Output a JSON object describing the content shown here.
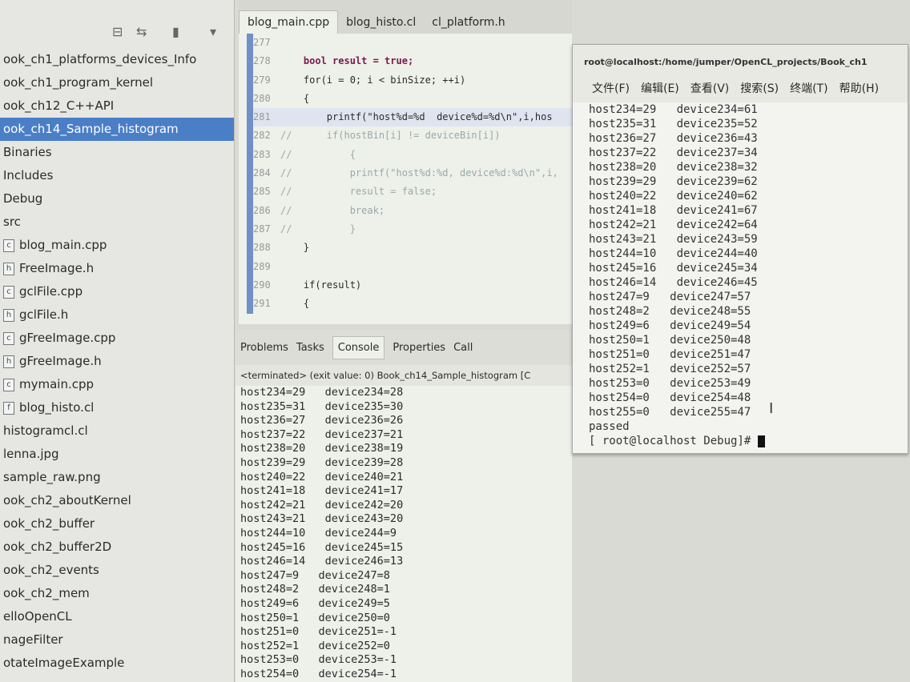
{
  "sidebar": {
    "items": [
      {
        "label": "ook_ch1_platforms_devices_Info",
        "icon": ""
      },
      {
        "label": "ook_ch1_program_kernel",
        "icon": ""
      },
      {
        "label": "ook_ch12_C++API",
        "icon": ""
      },
      {
        "label": "ook_ch14_Sample_histogram",
        "icon": "",
        "selected": true
      },
      {
        "label": "Binaries",
        "icon": ""
      },
      {
        "label": "Includes",
        "icon": ""
      },
      {
        "label": "Debug",
        "icon": ""
      },
      {
        "label": "src",
        "icon": ""
      },
      {
        "label": "blog_main.cpp",
        "icon": "c"
      },
      {
        "label": "FreeImage.h",
        "icon": "h"
      },
      {
        "label": "gclFile.cpp",
        "icon": "c"
      },
      {
        "label": "gclFile.h",
        "icon": "h"
      },
      {
        "label": "gFreeImage.cpp",
        "icon": "c"
      },
      {
        "label": "gFreeImage.h",
        "icon": "h"
      },
      {
        "label": "mymain.cpp",
        "icon": "c"
      },
      {
        "label": "blog_histo.cl",
        "icon": "f"
      },
      {
        "label": "histogramcl.cl",
        "icon": ""
      },
      {
        "label": "lenna.jpg",
        "icon": ""
      },
      {
        "label": "sample_raw.png",
        "icon": ""
      },
      {
        "label": "ook_ch2_aboutKernel",
        "icon": ""
      },
      {
        "label": "ook_ch2_buffer",
        "icon": ""
      },
      {
        "label": "ook_ch2_buffer2D",
        "icon": ""
      },
      {
        "label": "ook_ch2_events",
        "icon": ""
      },
      {
        "label": "ook_ch2_mem",
        "icon": ""
      },
      {
        "label": "elloOpenCL",
        "icon": ""
      },
      {
        "label": "nageFilter",
        "icon": ""
      },
      {
        "label": "otateImageExample",
        "icon": ""
      }
    ]
  },
  "editor": {
    "tabs": [
      "blog_main.cpp",
      "blog_histo.cl",
      "cl_platform.h"
    ],
    "lines": [
      {
        "n": "277",
        "code": "",
        "t": ""
      },
      {
        "n": "278",
        "code": "    bool result = true;",
        "t": "kw"
      },
      {
        "n": "279",
        "code": "    for(i = 0; i < binSize; ++i)",
        "t": ""
      },
      {
        "n": "280",
        "code": "    {",
        "t": ""
      },
      {
        "n": "281",
        "code": "        printf(\"host%d=%d  device%d=%d\\n\",i,hos",
        "t": "hl"
      },
      {
        "n": "282",
        "code": "//      if(hostBin[i] != deviceBin[i])",
        "t": "cm"
      },
      {
        "n": "283",
        "code": "//          {",
        "t": "cm"
      },
      {
        "n": "284",
        "code": "//          printf(\"host%d:%d, device%d:%d\\n\",i,",
        "t": "cm"
      },
      {
        "n": "285",
        "code": "//          result = false;",
        "t": "cm"
      },
      {
        "n": "286",
        "code": "//          break;",
        "t": "cm"
      },
      {
        "n": "287",
        "code": "//          }",
        "t": "cm"
      },
      {
        "n": "288",
        "code": "    }",
        "t": ""
      },
      {
        "n": "289",
        "code": "",
        "t": ""
      },
      {
        "n": "290",
        "code": "    if(result)",
        "t": ""
      },
      {
        "n": "291",
        "code": "    {",
        "t": ""
      }
    ]
  },
  "console": {
    "tabs": [
      "Problems",
      "Tasks",
      "Console",
      "Properties",
      "Call"
    ],
    "status": "<terminated> (exit value: 0) Book_ch14_Sample_histogram [C",
    "rows": [
      "host234=29   device234=28",
      "host235=31   device235=30",
      "host236=27   device236=26",
      "host237=22   device237=21",
      "host238=20   device238=19",
      "host239=29   device239=28",
      "host240=22   device240=21",
      "host241=18   device241=17",
      "host242=21   device242=20",
      "host243=21   device243=20",
      "host244=10   device244=9",
      "host245=16   device245=15",
      "host246=14   device246=13",
      "host247=9   device247=8",
      "host248=2   device248=1",
      "host249=6   device249=5",
      "host250=1   device250=0",
      "host251=0   device251=-1",
      "host252=1   device252=0",
      "host253=0   device253=-1",
      "host254=0   device254=-1"
    ]
  },
  "terminal": {
    "title": "root@localhost:/home/jumper/OpenCL_projects/Book_ch1",
    "menu": [
      "文件(F)",
      "编辑(E)",
      "查看(V)",
      "搜索(S)",
      "终端(T)",
      "帮助(H)"
    ],
    "rows": [
      "host234=29   device234=61",
      "host235=31   device235=52",
      "host236=27   device236=43",
      "host237=22   device237=34",
      "host238=20   device238=32",
      "host239=29   device239=62",
      "host240=22   device240=62",
      "host241=18   device241=67",
      "host242=21   device242=64",
      "host243=21   device243=59",
      "host244=10   device244=40",
      "host245=16   device245=34",
      "host246=14   device246=45",
      "host247=9   device247=57",
      "host248=2   device248=55",
      "host249=6   device249=54",
      "host250=1   device250=48",
      "host251=0   device251=47",
      "host252=1   device252=57",
      "host253=0   device253=49",
      "host254=0   device254=48",
      "host255=0   device255=47",
      "passed"
    ],
    "prompt": "[ root@localhost Debug]# "
  }
}
